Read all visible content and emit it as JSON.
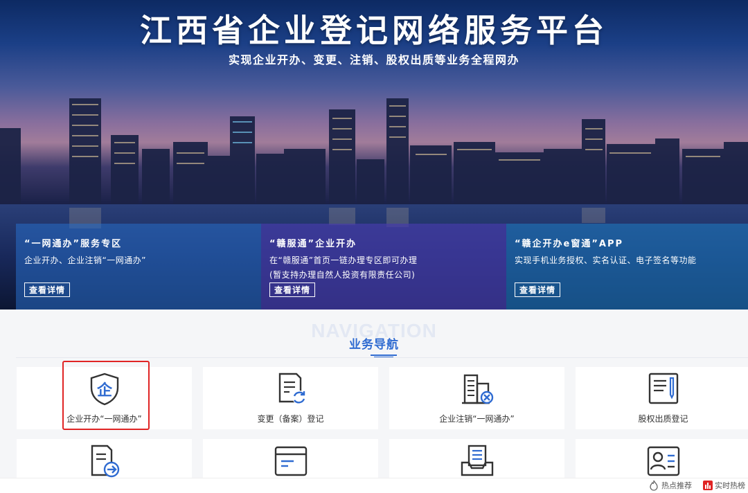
{
  "banner": {
    "title": "江西省企业登记网络服务平台",
    "subtitle": "实现企业开办、变更、注销、股权出质等业务全程网办",
    "cards": [
      {
        "title": "“一网通办”服务专区",
        "lines": [
          "企业开办、企业注销“一网通办”"
        ],
        "button": "查看详情"
      },
      {
        "title": "“赣服通”企业开办",
        "lines": [
          "在“赣服通”首页一链办理专区即可办理",
          "(暂支持办理自然人投资有限责任公司)"
        ],
        "button": "查看详情"
      },
      {
        "title": "“赣企开办e窗通”APP",
        "lines": [
          "实现手机业务授权、实名认证、电子签名等功能"
        ],
        "button": "查看详情"
      }
    ]
  },
  "navigation": {
    "bg_text": "NAVIGATION",
    "title": "业务导航",
    "tiles": [
      {
        "label": "企业开办“一网通办”",
        "icon": "enterprise-shield-icon",
        "highlighted": true
      },
      {
        "label": "变更（备案）登记",
        "icon": "document-refresh-icon"
      },
      {
        "label": "企业注销“一网通办”",
        "icon": "building-cancel-icon"
      },
      {
        "label": "股权出质登记",
        "icon": "document-pen-icon"
      },
      {
        "label": "",
        "icon": "document-arrow-icon"
      },
      {
        "label": "",
        "icon": "window-form-icon"
      },
      {
        "label": "",
        "icon": "tray-document-icon"
      },
      {
        "label": "",
        "icon": "id-card-icon"
      }
    ]
  },
  "bottom_bar": {
    "hot_recommend": "热点推荐",
    "realtime_hot": "实时热榜"
  },
  "colors": {
    "accent": "#2f6bd1",
    "highlight_border": "#e02424"
  }
}
